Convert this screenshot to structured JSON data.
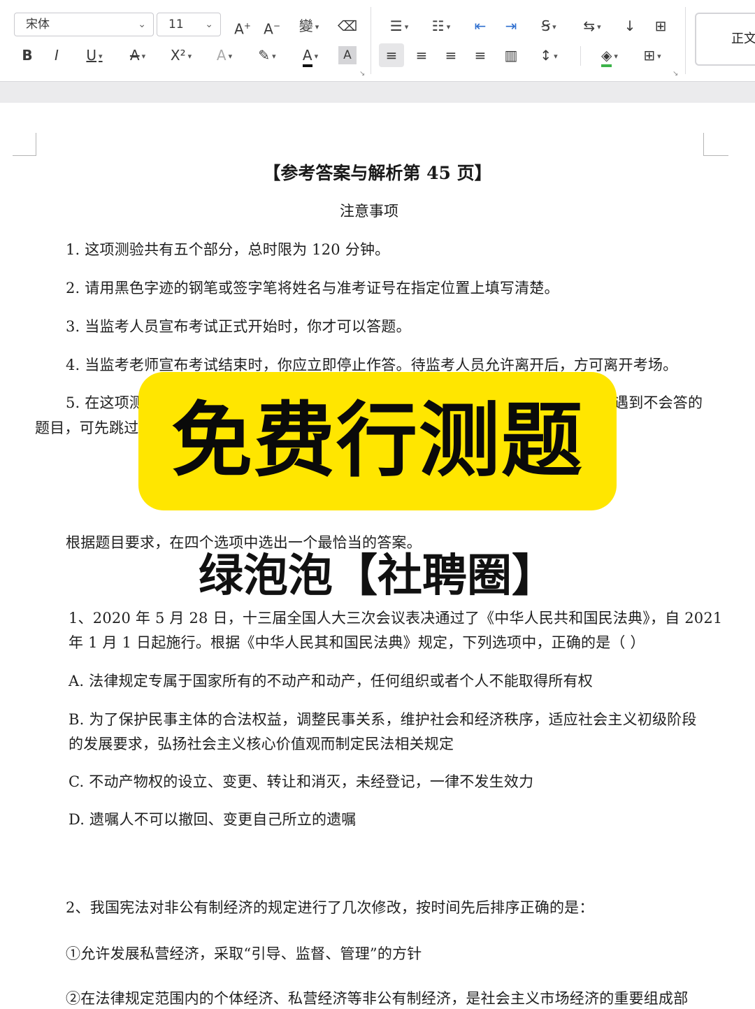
{
  "toolbar": {
    "font_name": "宋体",
    "font_size": "11",
    "style_preview": "正文",
    "row1": [
      {
        "id": "grow-font",
        "glyph": "A⁺"
      },
      {
        "id": "shrink-font",
        "glyph": "A⁻"
      },
      {
        "id": "phonetic",
        "glyph": "變"
      },
      {
        "id": "clear-format",
        "glyph": "⌫"
      },
      {
        "id": "bullets",
        "glyph": "☰"
      },
      {
        "id": "numbering",
        "glyph": "☷"
      },
      {
        "id": "decrease-indent",
        "glyph": "⇤"
      },
      {
        "id": "increase-indent",
        "glyph": "⇥"
      },
      {
        "id": "text-direction",
        "glyph": "Ꞩ"
      },
      {
        "id": "line-spacing-ab",
        "glyph": "⇆"
      },
      {
        "id": "sort",
        "glyph": "↓"
      },
      {
        "id": "show-marks",
        "glyph": "⊞"
      }
    ],
    "row2": [
      {
        "id": "bold",
        "glyph": "B"
      },
      {
        "id": "italic",
        "glyph": "I"
      },
      {
        "id": "underline",
        "glyph": "U"
      },
      {
        "id": "strikethrough",
        "glyph": "A̶"
      },
      {
        "id": "superscript",
        "glyph": "X²"
      },
      {
        "id": "text-effect",
        "glyph": "A"
      },
      {
        "id": "highlight",
        "glyph": "✎"
      },
      {
        "id": "font-color",
        "glyph": "A"
      },
      {
        "id": "char-shading",
        "glyph": "A"
      },
      {
        "id": "align-left",
        "glyph": "≡"
      },
      {
        "id": "align-center",
        "glyph": "≡"
      },
      {
        "id": "align-right",
        "glyph": "≡"
      },
      {
        "id": "justify",
        "glyph": "≡"
      },
      {
        "id": "distribute",
        "glyph": "▥"
      },
      {
        "id": "line-spacing",
        "glyph": "↕"
      },
      {
        "id": "shading",
        "glyph": "◈"
      },
      {
        "id": "borders",
        "glyph": "⊞"
      }
    ],
    "colors": {
      "font_color_bar": "#111111",
      "shading_bar": "#3cb34a"
    }
  },
  "document": {
    "title": "【参考答案与解析第 45 页】",
    "notice_heading": "注意事项",
    "notices": [
      "1. 这项测验共有五个部分，总时限为 120 分钟。",
      "2. 请用黑色字迹的钢笔或签字笔将姓名与准考证号在指定位置上填写清楚。",
      "3. 当监考人员宣布考试正式开始时，你才可以答题。",
      "4. 当监考老师宣布考试结束时，你应立即停止作答。待监考人员允许离开后，方可离开考场。"
    ],
    "notice5_start": "5. 在这项测",
    "notice5_end": "遇到不会答的",
    "notice5_line2": "题目，可先跳过",
    "instruction": "根据题目要求，在四个选项中选出一个最恰当的答案。",
    "q1_line1": "1、2020 年 5 月 28 日，十三届全国人大三次会议表决通过了《中华人民共和国民法典》，自 2021",
    "q1_line2": "年 1 月 1 日起施行。根据《中华人民其和国民法典》规定，下列选项中，正确的是（ ）",
    "q1_options": {
      "a": "A. 法律规定专属于国家所有的不动产和动产，任何组织或者个人不能取得所有权",
      "b1": "B. 为了保护民事主体的合法权益，调整民事关系，维护社会和经济秩序，适应社会主义初级阶段",
      "b2": "的发展要求，弘扬社会主义核心价值观而制定民法相关规定",
      "c": "C. 不动产物权的设立、变更、转让和消灭，未经登记，一律不发生效力",
      "d": "D. 遗嘱人不可以撤回、变更自己所立的遗嘱"
    },
    "q2_line1": "2、我国宪法对非公有制经济的规定进行了几次修改，按时间先后排序正确的是：",
    "q2_item1": "①允许发展私营经济，采取“引导、监督、管理”的方针",
    "q2_item2": "②在法律规定范围内的个体经济、私营经济等非公有制经济，是社会主义市场经济的重要组成部"
  },
  "overlay": {
    "banner_text": "免费行测题",
    "banner_color": "#ffe600",
    "watermark_text": "绿泡泡【社聘圈】"
  }
}
